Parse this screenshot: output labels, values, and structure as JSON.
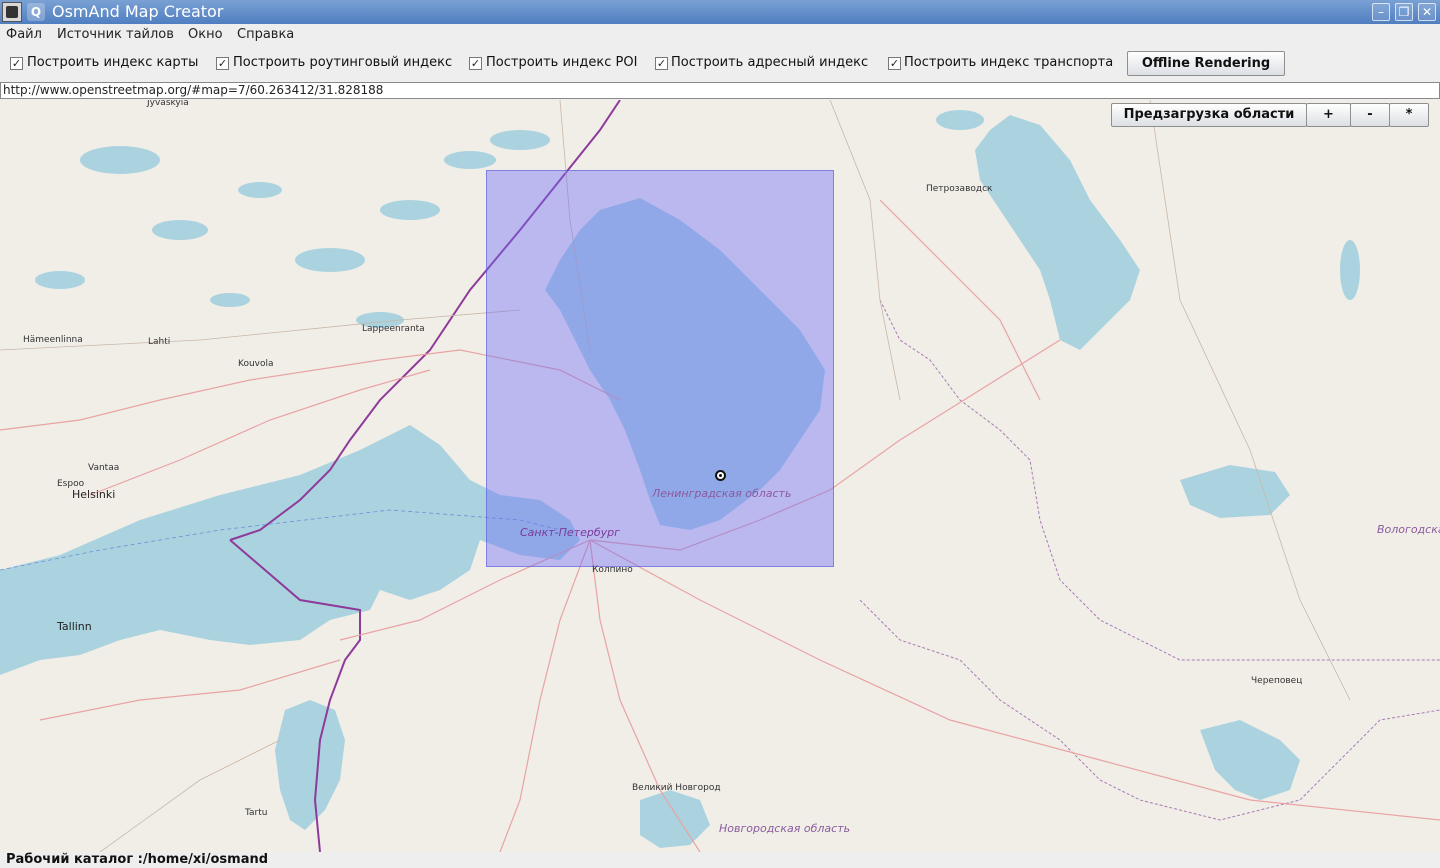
{
  "window": {
    "title": "OsmAnd Map Creator",
    "minimize_icon": "minimize-icon",
    "maximize_icon": "maximize-icon",
    "close_icon": "close-icon"
  },
  "menu": {
    "file": "Файл",
    "tile_source": "Источник тайлов",
    "window": "Окно",
    "help": "Справка"
  },
  "options": {
    "map_index": "Построить индекс карты",
    "routing_index": "Построить роутинговый индекс",
    "poi_index": "Построить индекс POI",
    "address_index": "Построить адресный индекс",
    "transport_index": "Построить индекс транспорта",
    "offline_rendering": "Offline Rendering",
    "all_checked": true
  },
  "url": "http://www.openstreetmap.org/#map=7/60.263412/31.828188",
  "map_tools": {
    "preload": "Предзагрузка области",
    "zoom_in": "+",
    "zoom_out": "-",
    "star": "*"
  },
  "map_labels": {
    "helsinki": "Helsinki",
    "espoo": "Espoo",
    "vantaa": "Vantaa",
    "tallinn": "Tallinn",
    "tartu": "Tartu",
    "hameenlinna": "Hämeenlinna",
    "lahti": "Lahti",
    "kouvola": "Kouvola",
    "lappeenranta": "Lappeenranta",
    "jyvaskyla": "Jyväskylä",
    "spb": "Санкт-Петербург",
    "kolpino": "Колпино",
    "lenoblast": "Ленинградская область",
    "petrozavodsk": "Петрозаводск",
    "vologda": "Вологодская",
    "cherepovets": "Череповец",
    "novgorod": "Великий Новгород",
    "novgorod_oblast": "Новгородская область"
  },
  "colors": {
    "water": "#aad3df",
    "land": "#f1eee8",
    "selection": "#6e6ef5",
    "border": "#8e3a9a",
    "titlebar": "#5a86c4"
  },
  "status": "Рабочий каталог :/home/xi/osmand"
}
